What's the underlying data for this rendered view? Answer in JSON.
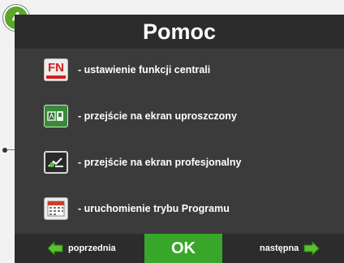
{
  "step": {
    "number": "4",
    "color": "#5aa82a"
  },
  "screen": {
    "title": "Pomoc"
  },
  "items": [
    {
      "icon": "fn-icon",
      "label": "- ustawienie funkcji centrali"
    },
    {
      "icon": "simple-screen-icon",
      "label": "- przejście na ekran uproszczony"
    },
    {
      "icon": "professional-screen-icon",
      "label": "- przejście na ekran profesjonalny"
    },
    {
      "icon": "calendar-icon",
      "label": "- uruchomienie trybu Programu"
    }
  ],
  "icon_text": {
    "fn": "FN"
  },
  "footer": {
    "prev_label": "poprzednia",
    "ok_label": "OK",
    "next_label": "następna",
    "arrow_color": "#57c12e",
    "ok_color": "#38a629"
  }
}
